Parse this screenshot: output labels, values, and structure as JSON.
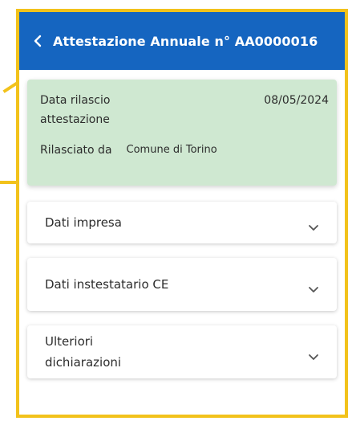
{
  "header": {
    "title": "Attestazione Annuale n° AA0000016",
    "bg_color": "#1565c0"
  },
  "info": {
    "data_rilascio_label": "Data rilascio attestazione",
    "data_rilascio_value": "08/05/2024",
    "rilasciato_da_label": "Rilasciato da",
    "rilasciato_da_value": "Comune di Torino",
    "bg_color": "#cfe8d1"
  },
  "accordions": [
    {
      "label": "Dati impresa"
    },
    {
      "label": "Dati instestatario CE"
    },
    {
      "label": "Ulteriori dichiarazioni"
    }
  ],
  "highlight_color": "#f2c21b"
}
